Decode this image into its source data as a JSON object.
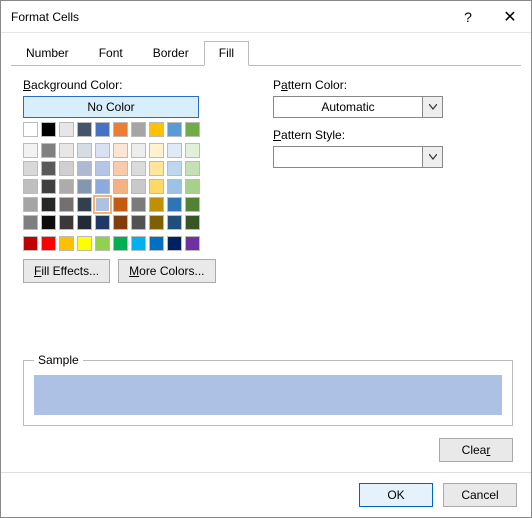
{
  "title": "Format Cells",
  "titlebar": {
    "help": "?",
    "close": "✕"
  },
  "tabs": [
    "Number",
    "Font",
    "Border",
    "Fill"
  ],
  "active_tab": 3,
  "left": {
    "bg_label": "Background Color:",
    "no_color": "No Color",
    "fill_effects": "Fill Effects...",
    "more_colors": "More Colors...",
    "selected_index": 34,
    "palette_top": [
      "#ffffff",
      "#000000",
      "#e7e6e6",
      "#44546a",
      "#4472c4",
      "#ed7d31",
      "#a5a5a5",
      "#ffc000",
      "#5b9bd5",
      "#70ad47"
    ],
    "palette_shades": [
      "#f2f2f2",
      "#808080",
      "#e8e7e6",
      "#d6dce4",
      "#d9e2f3",
      "#fbe5d5",
      "#ededed",
      "#fff2cc",
      "#deebf6",
      "#e2efd9",
      "#d8d8d8",
      "#595959",
      "#d0cece",
      "#adbad1",
      "#b4c6e7",
      "#f7cbac",
      "#dbdbdb",
      "#fee599",
      "#bdd7ee",
      "#c5e0b3",
      "#bfbfbf",
      "#3f3f3f",
      "#aeabab",
      "#8496b0",
      "#8eaadc",
      "#f4b183",
      "#c9c9c9",
      "#ffd965",
      "#9cc3e6",
      "#a8d08d",
      "#a5a5a5",
      "#262626",
      "#757070",
      "#323f4f",
      "#acc1e4",
      "#c55a11",
      "#7b7b7b",
      "#bf9000",
      "#2e75b5",
      "#538135",
      "#7f7f7f",
      "#0c0c0c",
      "#3a3838",
      "#222a35",
      "#1f3864",
      "#833c0b",
      "#525252",
      "#7f6000",
      "#1e4e79",
      "#375623"
    ],
    "palette_std": [
      "#c00000",
      "#ff0000",
      "#ffc000",
      "#ffff00",
      "#92d050",
      "#00b050",
      "#00b0f0",
      "#0070c0",
      "#002060",
      "#7030a0"
    ]
  },
  "right": {
    "pattern_color_label": "Pattern Color:",
    "pattern_color_value": "Automatic",
    "pattern_style_label": "Pattern Style:",
    "pattern_style_value": ""
  },
  "sample": {
    "label": "Sample",
    "color": "#acc1e4"
  },
  "buttons": {
    "clear": "Clear",
    "ok": "OK",
    "cancel": "Cancel"
  }
}
